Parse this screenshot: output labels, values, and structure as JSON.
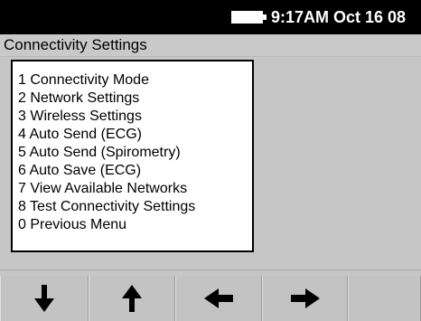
{
  "status_bar": {
    "clock": "9:17AM Oct 16 08",
    "battery_icon": "battery-icon"
  },
  "title_bar": {
    "title": "Connectivity Settings"
  },
  "menu": {
    "items": [
      {
        "label": "1 Connectivity Mode"
      },
      {
        "label": "2 Network Settings"
      },
      {
        "label": "3 Wireless Settings"
      },
      {
        "label": "4 Auto Send (ECG)"
      },
      {
        "label": "5 Auto Send (Spirometry)"
      },
      {
        "label": "6 Auto Save (ECG)"
      },
      {
        "label": "7 View Available Networks"
      },
      {
        "label": "8 Test Connectivity Settings"
      },
      {
        "label": "0 Previous Menu"
      }
    ]
  },
  "softkeys": [
    {
      "icon": "arrow-down-icon"
    },
    {
      "icon": "arrow-up-icon"
    },
    {
      "icon": "arrow-left-icon"
    },
    {
      "icon": "arrow-right-icon"
    },
    {
      "icon": ""
    }
  ],
  "colors": {
    "status_bar_bg": "#000000",
    "screen_bg": "#c6c6c6",
    "menu_bg": "#ffffff",
    "text": "#000000"
  }
}
